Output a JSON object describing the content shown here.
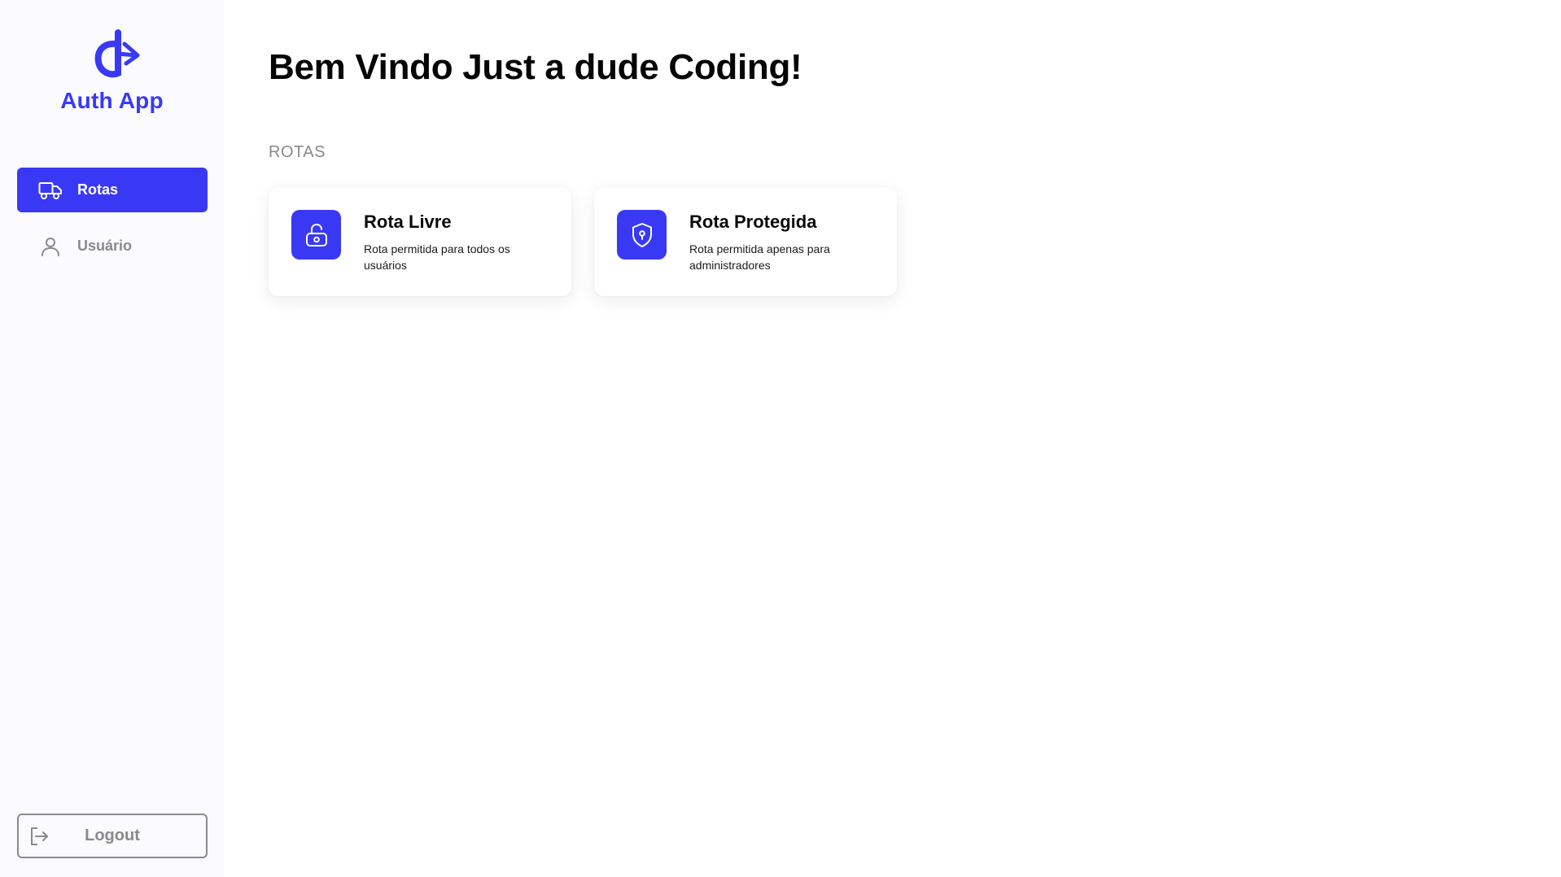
{
  "brand": {
    "name": "Auth App",
    "color": "#3939f5"
  },
  "sidebar": {
    "items": [
      {
        "label": "Rotas",
        "icon": "truck-icon",
        "active": true
      },
      {
        "label": "Usuário",
        "icon": "user-icon",
        "active": false
      }
    ],
    "logout_label": "Logout"
  },
  "main": {
    "title": "Bem Vindo Just a dude Coding!",
    "section_label": "ROTAS",
    "cards": [
      {
        "title": "Rota Livre",
        "description": "Rota permitida para todos os usuários",
        "icon": "unlock-icon"
      },
      {
        "title": "Rota Protegida",
        "description": "Rota permitida apenas para administradores",
        "icon": "shield-icon"
      }
    ]
  },
  "colors": {
    "accent": "#3939f5",
    "sidebar_bg": "#fafaff",
    "muted_text": "#8a8a8a"
  }
}
